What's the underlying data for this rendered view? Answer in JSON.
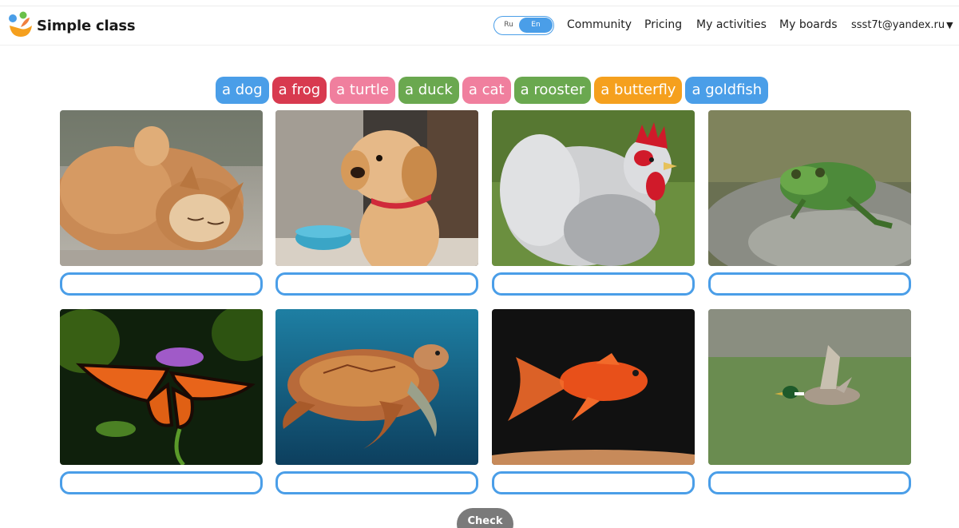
{
  "header": {
    "brand": "Simple class",
    "lang": {
      "ru": "Ru",
      "en": "En",
      "selected": "En"
    },
    "nav": [
      "Community",
      "Pricing",
      "My activities",
      "My boards"
    ],
    "user": "ssst7t@yandex.ru"
  },
  "words": [
    {
      "label": "a dog",
      "color": "#4a9ee8"
    },
    {
      "label": "a frog",
      "color": "#d83a4f"
    },
    {
      "label": "a turtle",
      "color": "#f07f9e"
    },
    {
      "label": "a duck",
      "color": "#6aa84f"
    },
    {
      "label": "a cat",
      "color": "#f07f9e"
    },
    {
      "label": "a rooster",
      "color": "#6aa84f"
    },
    {
      "label": "a butterfly",
      "color": "#f5a01e"
    },
    {
      "label": "a goldfish",
      "color": "#4a9ee8"
    }
  ],
  "cards": [
    {
      "image": "cat-photo",
      "answer": ""
    },
    {
      "image": "puppy-photo",
      "answer": ""
    },
    {
      "image": "rooster-photo",
      "answer": ""
    },
    {
      "image": "frog-photo",
      "answer": ""
    },
    {
      "image": "butterfly-photo",
      "answer": ""
    },
    {
      "image": "turtle-photo",
      "answer": ""
    },
    {
      "image": "goldfish-photo",
      "answer": ""
    },
    {
      "image": "duck-photo",
      "answer": ""
    }
  ],
  "check_label": "Check"
}
